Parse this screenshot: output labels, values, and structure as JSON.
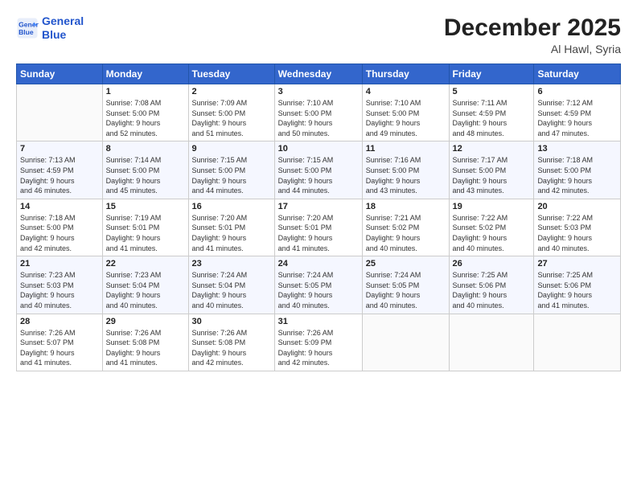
{
  "header": {
    "logo_line1": "General",
    "logo_line2": "Blue",
    "month": "December 2025",
    "location": "Al Hawl, Syria"
  },
  "weekdays": [
    "Sunday",
    "Monday",
    "Tuesday",
    "Wednesday",
    "Thursday",
    "Friday",
    "Saturday"
  ],
  "weeks": [
    [
      {
        "day": "",
        "info": ""
      },
      {
        "day": "1",
        "info": "Sunrise: 7:08 AM\nSunset: 5:00 PM\nDaylight: 9 hours\nand 52 minutes."
      },
      {
        "day": "2",
        "info": "Sunrise: 7:09 AM\nSunset: 5:00 PM\nDaylight: 9 hours\nand 51 minutes."
      },
      {
        "day": "3",
        "info": "Sunrise: 7:10 AM\nSunset: 5:00 PM\nDaylight: 9 hours\nand 50 minutes."
      },
      {
        "day": "4",
        "info": "Sunrise: 7:10 AM\nSunset: 5:00 PM\nDaylight: 9 hours\nand 49 minutes."
      },
      {
        "day": "5",
        "info": "Sunrise: 7:11 AM\nSunset: 4:59 PM\nDaylight: 9 hours\nand 48 minutes."
      },
      {
        "day": "6",
        "info": "Sunrise: 7:12 AM\nSunset: 4:59 PM\nDaylight: 9 hours\nand 47 minutes."
      }
    ],
    [
      {
        "day": "7",
        "info": "Sunrise: 7:13 AM\nSunset: 4:59 PM\nDaylight: 9 hours\nand 46 minutes."
      },
      {
        "day": "8",
        "info": "Sunrise: 7:14 AM\nSunset: 5:00 PM\nDaylight: 9 hours\nand 45 minutes."
      },
      {
        "day": "9",
        "info": "Sunrise: 7:15 AM\nSunset: 5:00 PM\nDaylight: 9 hours\nand 44 minutes."
      },
      {
        "day": "10",
        "info": "Sunrise: 7:15 AM\nSunset: 5:00 PM\nDaylight: 9 hours\nand 44 minutes."
      },
      {
        "day": "11",
        "info": "Sunrise: 7:16 AM\nSunset: 5:00 PM\nDaylight: 9 hours\nand 43 minutes."
      },
      {
        "day": "12",
        "info": "Sunrise: 7:17 AM\nSunset: 5:00 PM\nDaylight: 9 hours\nand 43 minutes."
      },
      {
        "day": "13",
        "info": "Sunrise: 7:18 AM\nSunset: 5:00 PM\nDaylight: 9 hours\nand 42 minutes."
      }
    ],
    [
      {
        "day": "14",
        "info": "Sunrise: 7:18 AM\nSunset: 5:00 PM\nDaylight: 9 hours\nand 42 minutes."
      },
      {
        "day": "15",
        "info": "Sunrise: 7:19 AM\nSunset: 5:01 PM\nDaylight: 9 hours\nand 41 minutes."
      },
      {
        "day": "16",
        "info": "Sunrise: 7:20 AM\nSunset: 5:01 PM\nDaylight: 9 hours\nand 41 minutes."
      },
      {
        "day": "17",
        "info": "Sunrise: 7:20 AM\nSunset: 5:01 PM\nDaylight: 9 hours\nand 41 minutes."
      },
      {
        "day": "18",
        "info": "Sunrise: 7:21 AM\nSunset: 5:02 PM\nDaylight: 9 hours\nand 40 minutes."
      },
      {
        "day": "19",
        "info": "Sunrise: 7:22 AM\nSunset: 5:02 PM\nDaylight: 9 hours\nand 40 minutes."
      },
      {
        "day": "20",
        "info": "Sunrise: 7:22 AM\nSunset: 5:03 PM\nDaylight: 9 hours\nand 40 minutes."
      }
    ],
    [
      {
        "day": "21",
        "info": "Sunrise: 7:23 AM\nSunset: 5:03 PM\nDaylight: 9 hours\nand 40 minutes."
      },
      {
        "day": "22",
        "info": "Sunrise: 7:23 AM\nSunset: 5:04 PM\nDaylight: 9 hours\nand 40 minutes."
      },
      {
        "day": "23",
        "info": "Sunrise: 7:24 AM\nSunset: 5:04 PM\nDaylight: 9 hours\nand 40 minutes."
      },
      {
        "day": "24",
        "info": "Sunrise: 7:24 AM\nSunset: 5:05 PM\nDaylight: 9 hours\nand 40 minutes."
      },
      {
        "day": "25",
        "info": "Sunrise: 7:24 AM\nSunset: 5:05 PM\nDaylight: 9 hours\nand 40 minutes."
      },
      {
        "day": "26",
        "info": "Sunrise: 7:25 AM\nSunset: 5:06 PM\nDaylight: 9 hours\nand 40 minutes."
      },
      {
        "day": "27",
        "info": "Sunrise: 7:25 AM\nSunset: 5:06 PM\nDaylight: 9 hours\nand 41 minutes."
      }
    ],
    [
      {
        "day": "28",
        "info": "Sunrise: 7:26 AM\nSunset: 5:07 PM\nDaylight: 9 hours\nand 41 minutes."
      },
      {
        "day": "29",
        "info": "Sunrise: 7:26 AM\nSunset: 5:08 PM\nDaylight: 9 hours\nand 41 minutes."
      },
      {
        "day": "30",
        "info": "Sunrise: 7:26 AM\nSunset: 5:08 PM\nDaylight: 9 hours\nand 42 minutes."
      },
      {
        "day": "31",
        "info": "Sunrise: 7:26 AM\nSunset: 5:09 PM\nDaylight: 9 hours\nand 42 minutes."
      },
      {
        "day": "",
        "info": ""
      },
      {
        "day": "",
        "info": ""
      },
      {
        "day": "",
        "info": ""
      }
    ]
  ]
}
